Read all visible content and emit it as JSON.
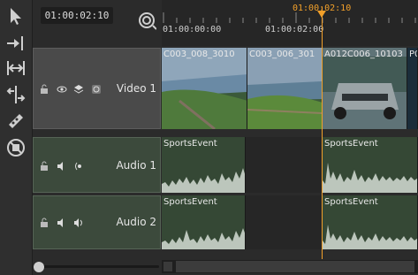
{
  "timecode": {
    "current": "01:00:02:10"
  },
  "ruler": {
    "playhead_label": "01:00:02:10",
    "tick_labels": [
      "01:00:00:00",
      "01:00:02:00"
    ]
  },
  "tracks": {
    "video1": {
      "name": "Video 1",
      "clips": [
        "C003_008_3010",
        "C003_006_301",
        "A012C006_10103",
        "P0"
      ]
    },
    "audio1": {
      "name": "Audio 1",
      "clips": [
        "SportsEvent",
        "SportsEvent"
      ]
    },
    "audio2": {
      "name": "Audio 2",
      "clips": [
        "SportsEvent",
        "SportsEvent"
      ]
    }
  },
  "toolbar": {
    "tools": [
      "select-arrow-icon",
      "track-forward-icon",
      "fit-range-icon",
      "slip-icon",
      "razor-icon",
      "delete-track-icon"
    ]
  },
  "colors": {
    "playhead": "#f2a02a",
    "audio_clip": "#354835",
    "waveform": "#bcc6bc"
  }
}
